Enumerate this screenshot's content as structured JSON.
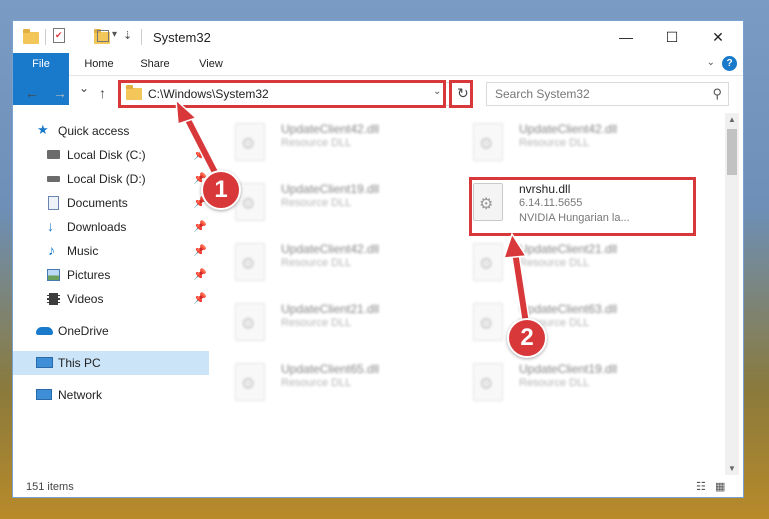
{
  "window": {
    "title": "System32",
    "minimize": "—",
    "maximize": "☐",
    "close": "✕"
  },
  "quick_access_toolbar": {
    "dropdown": "▾"
  },
  "ribbon": {
    "tabs": [
      {
        "label": "File"
      },
      {
        "label": "Home"
      },
      {
        "label": "Share"
      },
      {
        "label": "View"
      }
    ],
    "help": "?"
  },
  "navigation": {
    "back": "←",
    "forward": "→",
    "recent": "⌄",
    "up": "↑",
    "address_path": "C:\\Windows\\System32",
    "search_placeholder": "Search System32"
  },
  "sidebar": {
    "items": [
      {
        "label": "Quick access",
        "icon": "star-icon"
      },
      {
        "label": "Local Disk (C:)",
        "icon": "drive-icon",
        "pinned": true
      },
      {
        "label": "Local Disk (D:)",
        "icon": "drive-icon",
        "pinned": true
      },
      {
        "label": "Documents",
        "icon": "document-icon",
        "pinned": true
      },
      {
        "label": "Downloads",
        "icon": "download-icon",
        "pinned": true
      },
      {
        "label": "Music",
        "icon": "music-icon",
        "pinned": true
      },
      {
        "label": "Pictures",
        "icon": "pictures-icon",
        "pinned": true
      },
      {
        "label": "Videos",
        "icon": "videos-icon",
        "pinned": true
      },
      {
        "label": "OneDrive",
        "icon": "cloud-icon"
      },
      {
        "label": "This PC",
        "icon": "computer-icon",
        "selected": true
      },
      {
        "label": "Network",
        "icon": "network-icon"
      }
    ],
    "pin_glyph": "📌"
  },
  "files": [
    {
      "name": "UpdateClient42.dll",
      "type": "Resource DLL"
    },
    {
      "name": "UpdateClient42.dll",
      "type": "Resource DLL"
    },
    {
      "name": "UpdateClient19.dll",
      "type": "Resource DLL"
    },
    {
      "name": "nvrshu.dll",
      "version": "6.14.11.5655",
      "description": "NVIDIA Hungarian la...",
      "highlighted": true
    },
    {
      "name": "UpdateClient42.dll",
      "type": "Resource DLL"
    },
    {
      "name": "UpdateClient21.dll",
      "type": "Resource DLL"
    },
    {
      "name": "UpdateClient21.dll",
      "type": "Resource DLL"
    },
    {
      "name": "UpdateClient63.dll",
      "type": "Resource DLL"
    },
    {
      "name": "UpdateClient65.dll",
      "type": "Resource DLL"
    },
    {
      "name": "UpdateClient19.dll",
      "type": "Resource DLL"
    }
  ],
  "status": {
    "item_count": "151 items"
  },
  "callouts": [
    {
      "label": "1"
    },
    {
      "label": "2"
    }
  ],
  "colors": {
    "accent": "#1979ca",
    "highlight": "#d9383a",
    "selected": "#cce4f7"
  }
}
